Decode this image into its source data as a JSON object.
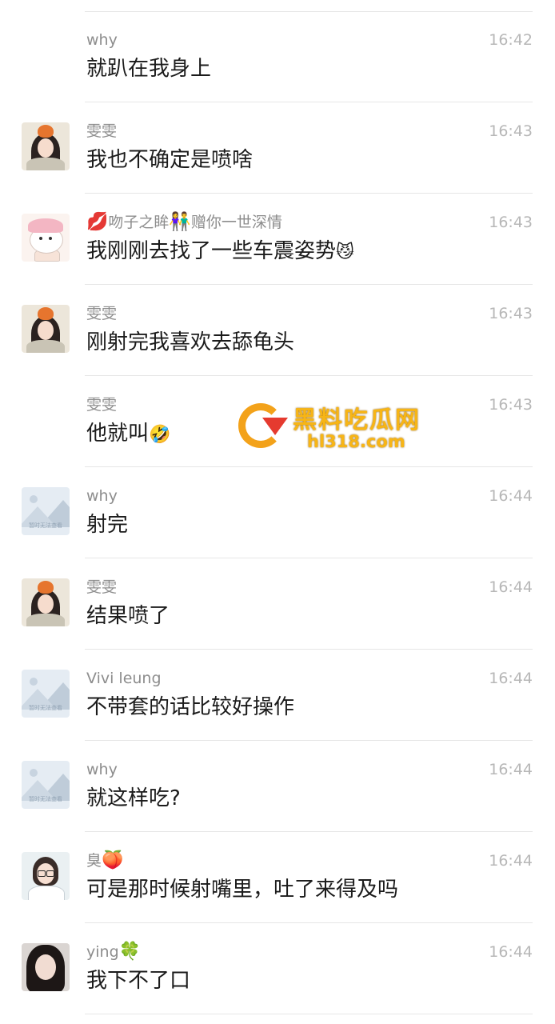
{
  "messages": [
    {
      "avatar": "none",
      "name": "why",
      "time": "16:42",
      "text": "就趴在我身上"
    },
    {
      "avatar": "girl-orange-hat",
      "name": "雯雯",
      "time": "16:43",
      "text": "我也不确定是喷啥"
    },
    {
      "avatar": "cartoon-bear",
      "name_prefix_emoji": "💋",
      "name": "吻子之眸",
      "name_mid_emoji": "👫",
      "name_suffix": "赠你一世深情",
      "time": "16:43",
      "text": "我刚刚去找了一些车震姿势",
      "text_emoji": "😼"
    },
    {
      "avatar": "girl-orange-hat",
      "name": "雯雯",
      "time": "16:43",
      "text": "刚射完我喜欢去舔龟头"
    },
    {
      "avatar": "none",
      "name": "雯雯",
      "time": "16:43",
      "text": "他就叫",
      "text_emoji": "🤣"
    },
    {
      "avatar": "placeholder",
      "name": "why",
      "time": "16:44",
      "text": "射完"
    },
    {
      "avatar": "girl-orange-hat",
      "name": "雯雯",
      "time": "16:44",
      "text": "结果喷了"
    },
    {
      "avatar": "placeholder",
      "name": "Vivi leung",
      "time": "16:44",
      "text": "不带套的话比较好操作"
    },
    {
      "avatar": "placeholder",
      "name": "why",
      "time": "16:44",
      "text": "就这样吃?"
    },
    {
      "avatar": "girl-glasses",
      "name": "臭",
      "name_suffix_emoji": "🍑",
      "time": "16:44",
      "text": "可是那时候射嘴里，吐了来得及吗"
    },
    {
      "avatar": "girl-photo",
      "name": "ying",
      "name_suffix_emoji": "🍀",
      "time": "16:44",
      "text": "我下不了口"
    }
  ],
  "avatar_placeholder_caption": "暂时无法查看",
  "watermark": {
    "title": "黑料吃瓜网",
    "url": "hl318.com"
  }
}
